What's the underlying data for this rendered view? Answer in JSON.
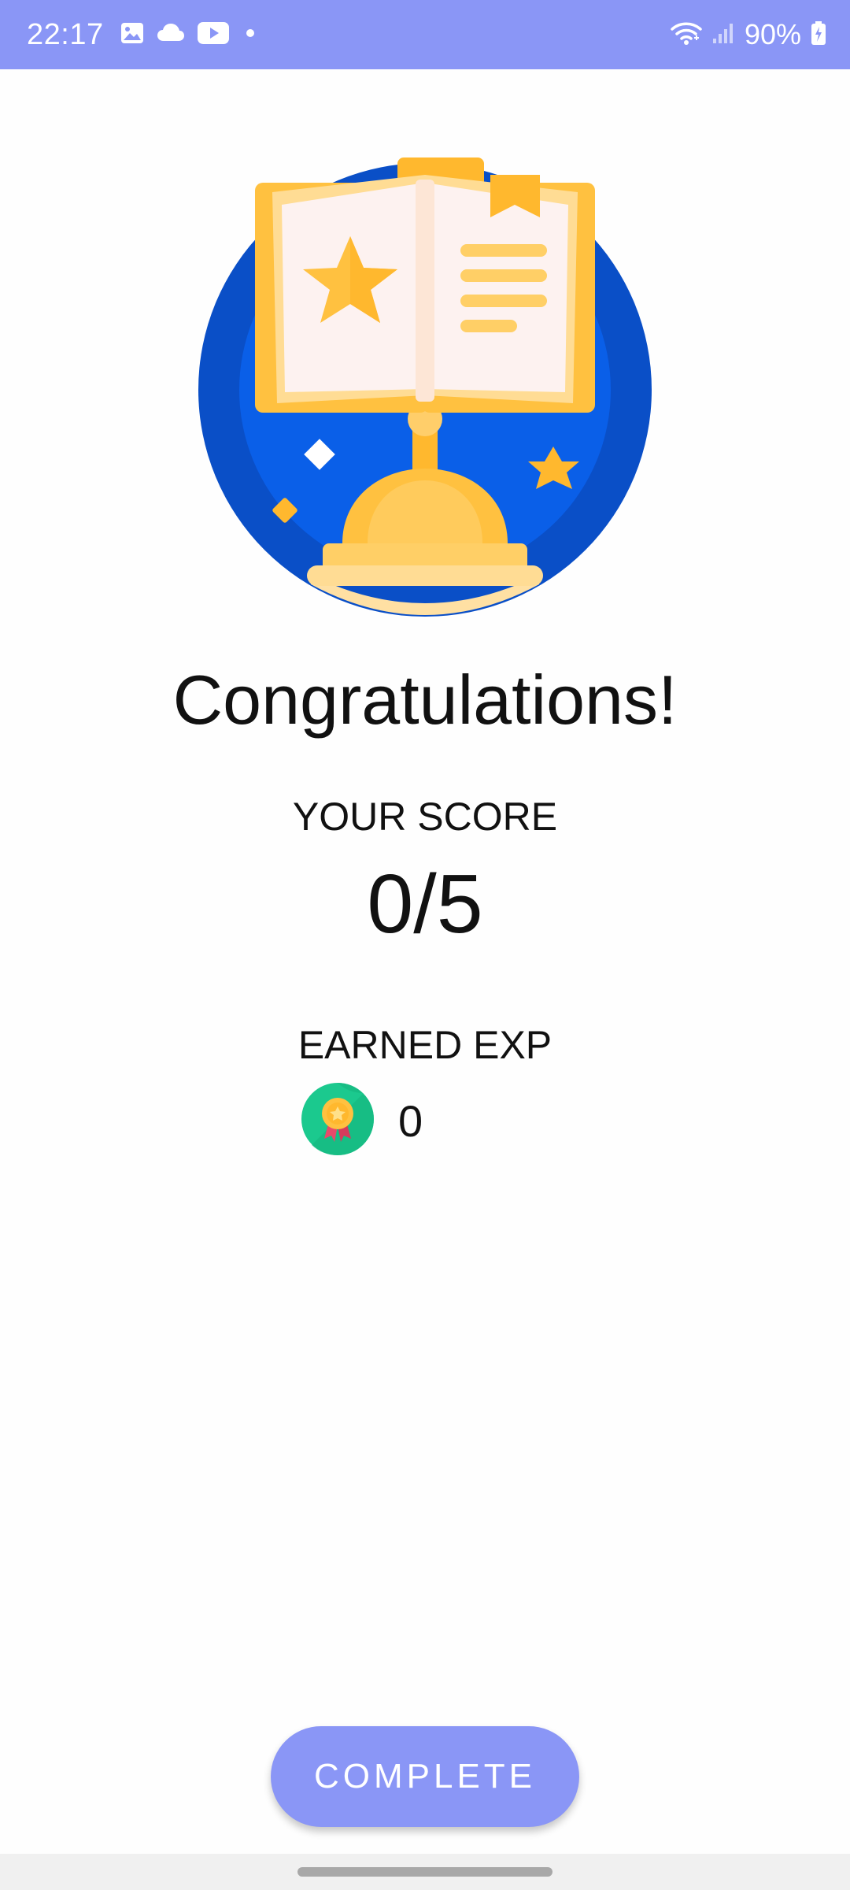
{
  "status_bar": {
    "time": "22:17",
    "battery": "90%",
    "color": "#8a96f6"
  },
  "result": {
    "title": "Congratulations!",
    "score_label": "YOUR SCORE",
    "score_value": "0/5",
    "exp_label": "EARNED EXP",
    "exp_value": "0"
  },
  "icons": {
    "hero": "trophy-book-illustration",
    "exp": "medal-icon"
  },
  "actions": {
    "complete_label": "COMPLETE",
    "accent_color": "#8a96f6"
  }
}
